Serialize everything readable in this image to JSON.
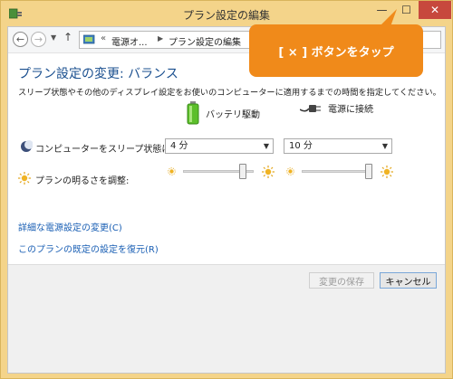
{
  "window": {
    "title": "プラン設定の編集",
    "colors": {
      "frame": "#f4d48a",
      "close": "#c7483d"
    }
  },
  "nav": {
    "breadcrumb_1": "電源オ...",
    "breadcrumb_2": "プラン設定の編集"
  },
  "callout": {
    "text": "[ × ] ボタンをタップ",
    "color": "#f08a1a"
  },
  "main": {
    "heading": "プラン設定の変更: バランス",
    "description": "スリープ状態やその他のディスプレイ設定をお使いのコンピューターに適用するまでの時間を指定してください。",
    "columns": {
      "battery": "バッテリ駆動",
      "plugged": "電源に接続"
    },
    "sleep": {
      "label": "コンピューターをスリープ状態にする:",
      "battery_value": "4 分",
      "plugged_value": "10 分"
    },
    "brightness": {
      "label": "プランの明るさを調整:",
      "battery_level": 0.88,
      "plugged_level": 1.0
    },
    "links": {
      "advanced": "詳細な電源設定の変更(C)",
      "restore": "このプランの既定の設定を復元(R)"
    }
  },
  "footer": {
    "save_label": "変更の保存",
    "cancel_label": "キャンセル"
  },
  "icons": [
    "power-options-icon",
    "minimize-icon",
    "maximize-icon",
    "close-icon",
    "back-icon",
    "forward-icon",
    "up-icon",
    "battery-icon",
    "plug-icon",
    "moon-icon",
    "sun-icon"
  ]
}
